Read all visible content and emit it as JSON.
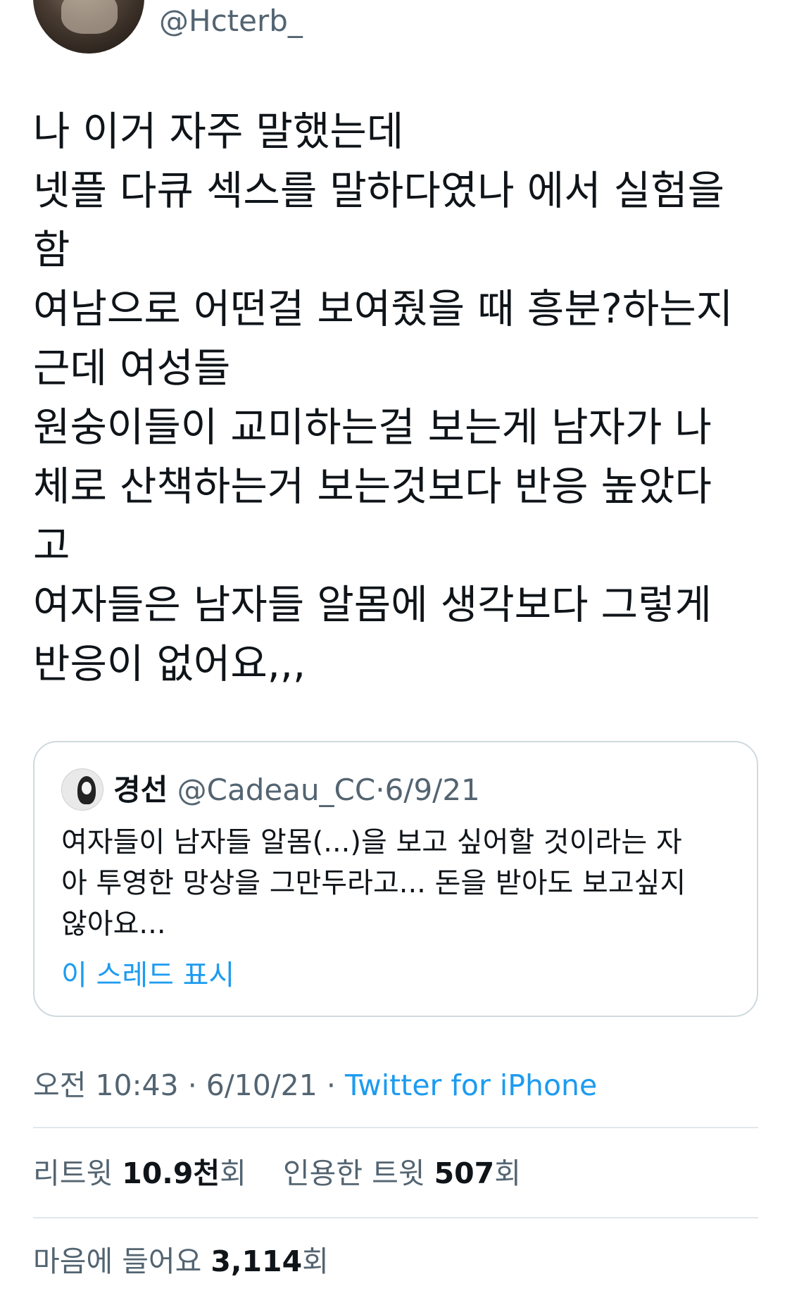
{
  "author": {
    "handle": "@Hcterb_"
  },
  "tweet": {
    "lines": [
      "나 이거 자주 말했는데",
      "넷플 다큐 섹스를 말하다였나 에서 실험을",
      "함",
      "여남으로 어떤걸 보여줬을 때 흥분?하는지",
      "근데 여성들",
      "원숭이들이 교미하는걸 보는게 남자가 나",
      "체로 산책하는거 보는것보다 반응 높았다",
      "고",
      "여자들은 남자들 알몸에 생각보다 그렇게",
      "반응이 없어요,,,"
    ]
  },
  "quoted_tweet": {
    "name": "경선",
    "handle": "@Cadeau_CC",
    "date": "6/9/21",
    "separator": "·",
    "lines": [
      "여자들이 남자들 알몸(...)을 보고 싶어할 것이라는 자",
      "아 투영한 망상을 그만두라고... 돈을 받아도 보고싶지",
      "않아요..."
    ],
    "show_thread_label": "이 스레드 표시"
  },
  "meta": {
    "time": "오전 10:43",
    "date": "6/10/21",
    "separator": "·",
    "source": "Twitter for iPhone"
  },
  "stats": {
    "retweets_label": "리트윗",
    "retweets_value": "10.9천",
    "retweets_suffix": "회",
    "quotes_label": "인용한 트윗",
    "quotes_value": "507",
    "quotes_suffix": "회",
    "likes_label": "마음에 들어요",
    "likes_value": "3,114",
    "likes_suffix": "회"
  }
}
